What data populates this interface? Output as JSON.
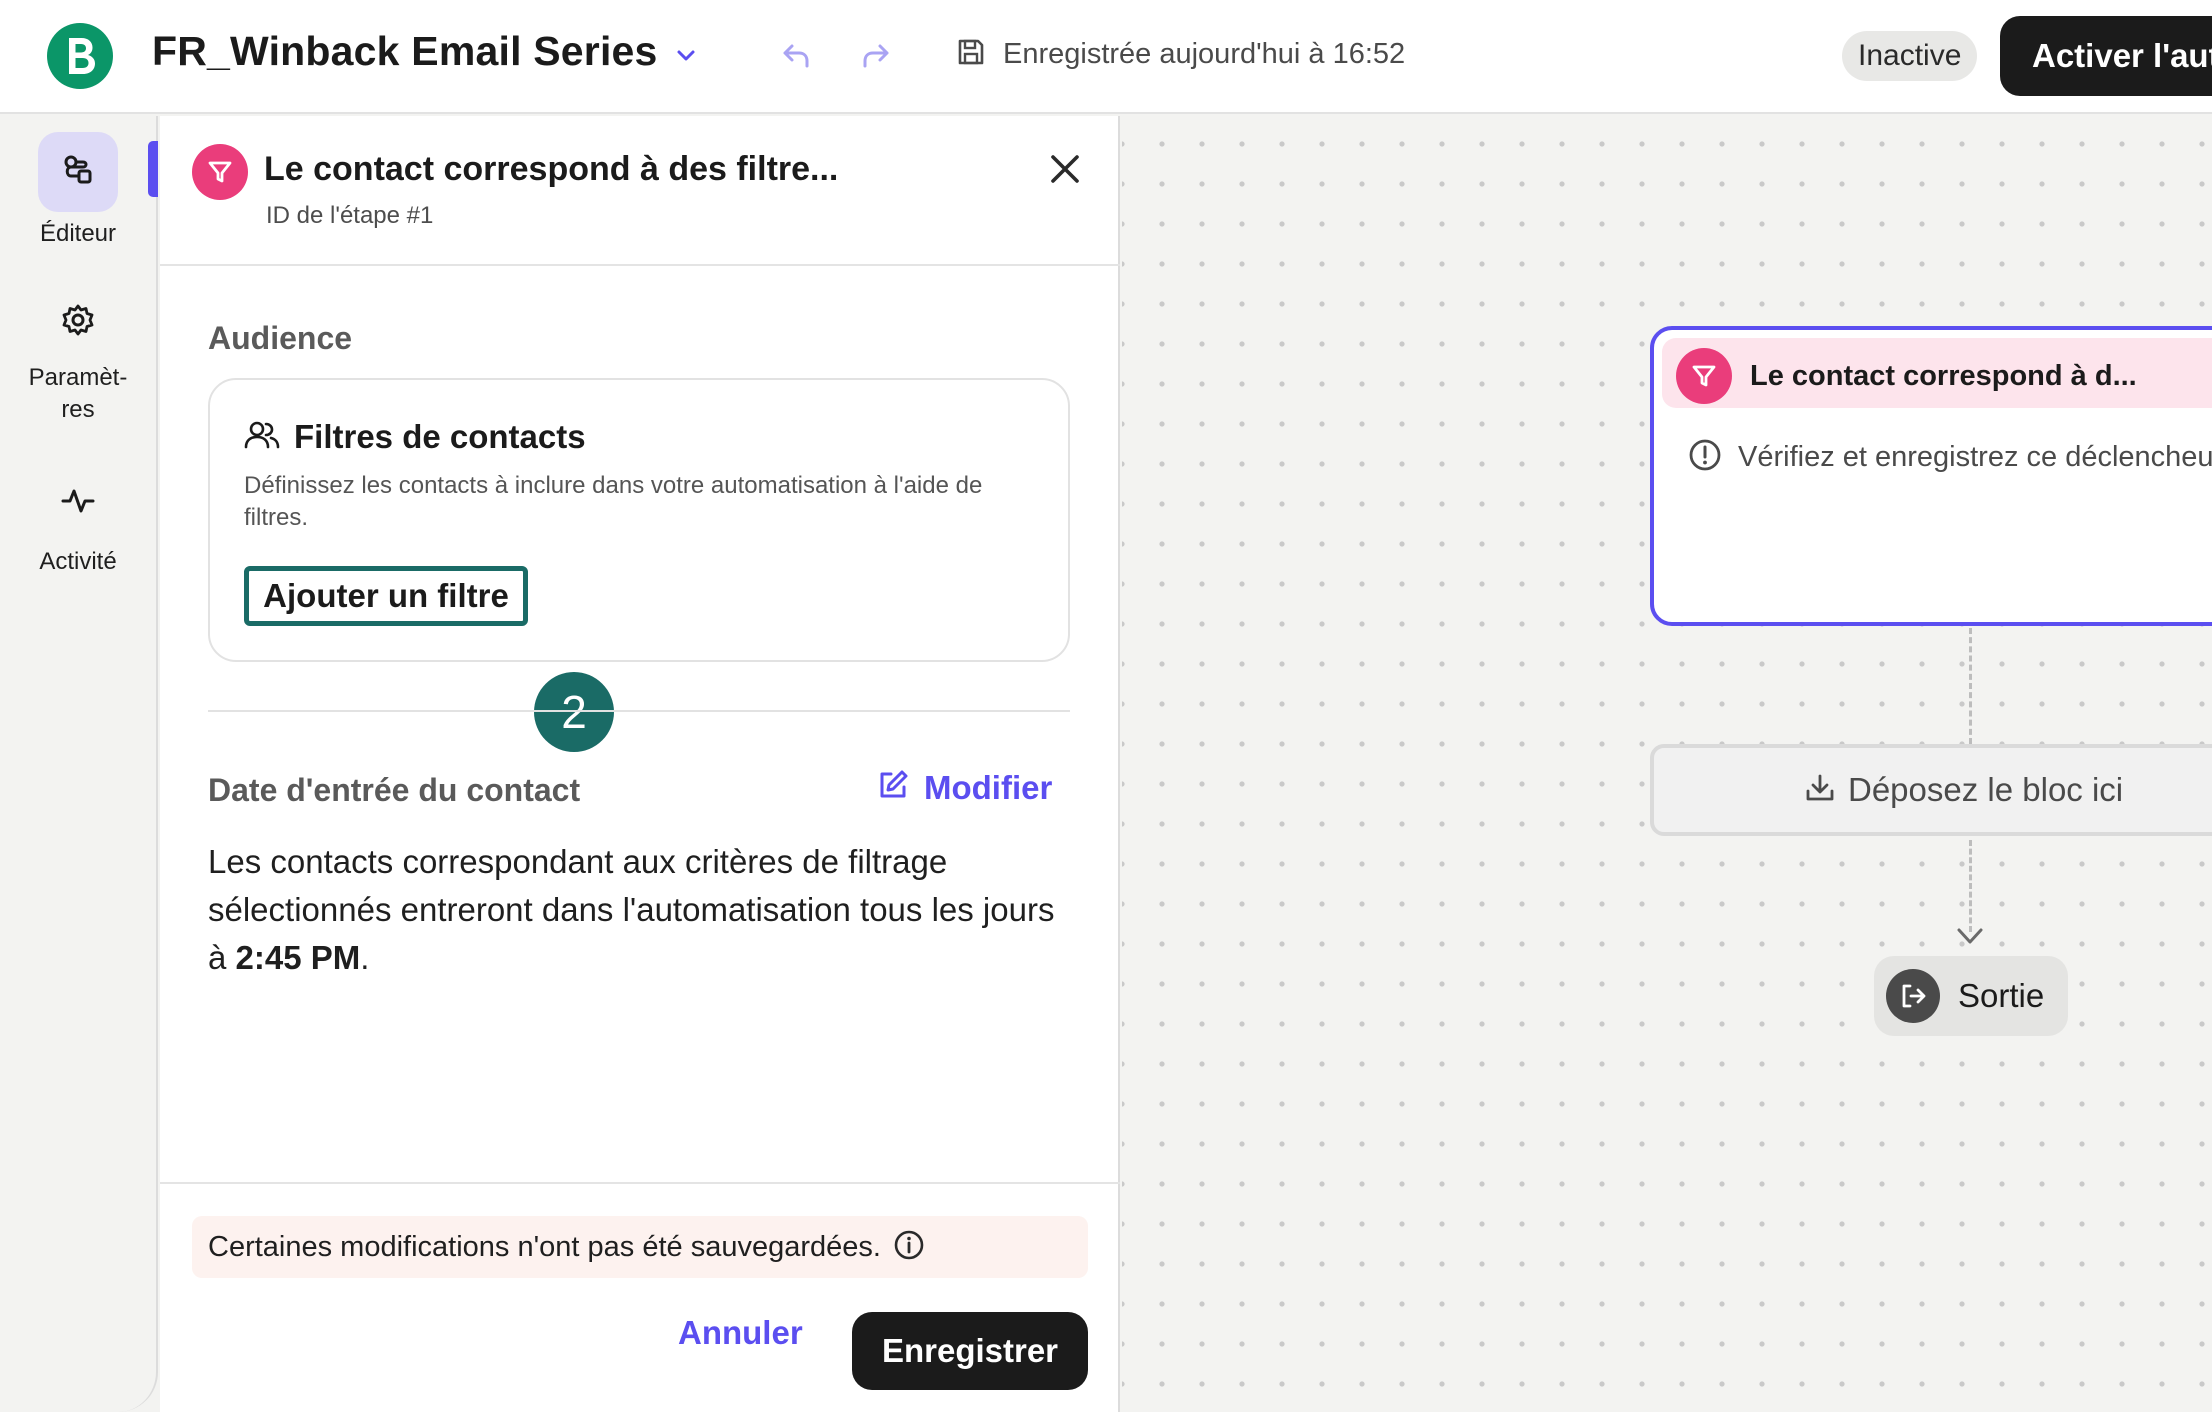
{
  "header": {
    "title": "FR_Winback Email Series",
    "saved_status": "Enregistrée aujourd'hui à 16:52",
    "state_badge": "Inactive",
    "activate_label": "Activer l'automatisation",
    "logo_letter": "B",
    "brand_color": "#0b9668"
  },
  "nav": {
    "items": [
      {
        "label": "Éditeur",
        "icon": "flow-icon",
        "active": true
      },
      {
        "label": "Paramèt-\nres",
        "icon": "gear-icon",
        "active": false
      },
      {
        "label": "Activité",
        "icon": "activity-icon",
        "active": false
      }
    ],
    "accent": "#5b4ef0"
  },
  "panel": {
    "title": "Le contact correspond à des filtre...",
    "subtitle": "ID de l'étape #1",
    "audience_heading": "Audience",
    "filter_card": {
      "title": "Filtres de contacts",
      "description": "Définissez les contacts à inclure dans votre automatisation à l'aide de filtres.",
      "add_button": "Ajouter un filtre",
      "step_badge": "2"
    },
    "entry": {
      "heading": "Date d'entrée du contact",
      "modify_label": "Modifier",
      "text_before": "Les contacts correspondant aux critères de filtrage sélectionnés entreront dans l'automatisation tous les jours à ",
      "time": "2:45 PM",
      "text_after": "."
    },
    "unsaved_notice": "Certaines modifications n'ont pas été sauvegardées.",
    "cancel_label": "Annuler",
    "save_label": "Enregistrer"
  },
  "canvas": {
    "trigger": {
      "title": "Le contact correspond à d...",
      "warning": "Vérifiez et enregistrez ce déclencheur"
    },
    "drop_zone": "Déposez le bloc ici",
    "exit": "Sortie"
  }
}
